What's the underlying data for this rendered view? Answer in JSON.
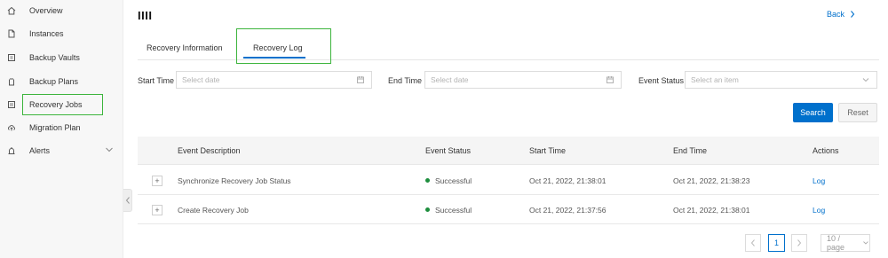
{
  "sidebar": {
    "items": [
      {
        "label": "Overview",
        "icon": "home-icon"
      },
      {
        "label": "Instances",
        "icon": "document-icon"
      },
      {
        "label": "Backup Vaults",
        "icon": "vault-icon"
      },
      {
        "label": "Backup Plans",
        "icon": "clipboard-icon"
      },
      {
        "label": "Recovery Jobs",
        "icon": "list-icon"
      },
      {
        "label": "Migration Plan",
        "icon": "cloud-upload-icon"
      },
      {
        "label": "Alerts",
        "icon": "alarm-icon"
      }
    ]
  },
  "header": {
    "title": "IIII",
    "back_label": "Back"
  },
  "tabs": [
    {
      "label": "Recovery Information",
      "active": false
    },
    {
      "label": "Recovery Log",
      "active": true
    }
  ],
  "filters": {
    "start_time_label": "Start Time :",
    "start_time_placeholder": "Select date",
    "end_time_label": "End Time :",
    "end_time_placeholder": "Select date",
    "event_status_label": "Event Status :",
    "event_status_placeholder": "Select an item",
    "search_label": "Search",
    "reset_label": "Reset"
  },
  "table": {
    "columns": [
      "Event Description",
      "Event Status",
      "Start Time",
      "End Time",
      "Actions"
    ],
    "rows": [
      {
        "description": "Synchronize Recovery Job Status",
        "status": "Successful",
        "start": "Oct 21, 2022, 21:38:01",
        "end": "Oct 21, 2022, 21:38:23",
        "action": "Log"
      },
      {
        "description": "Create Recovery Job",
        "status": "Successful",
        "start": "Oct 21, 2022, 21:37:56",
        "end": "Oct 21, 2022, 21:38:01",
        "action": "Log"
      }
    ]
  },
  "pagination": {
    "current_page": "1",
    "page_size": "10 / page"
  },
  "colors": {
    "accent": "#0070cc",
    "success": "#1e8e3e",
    "highlight_box": "#3cb43c"
  }
}
